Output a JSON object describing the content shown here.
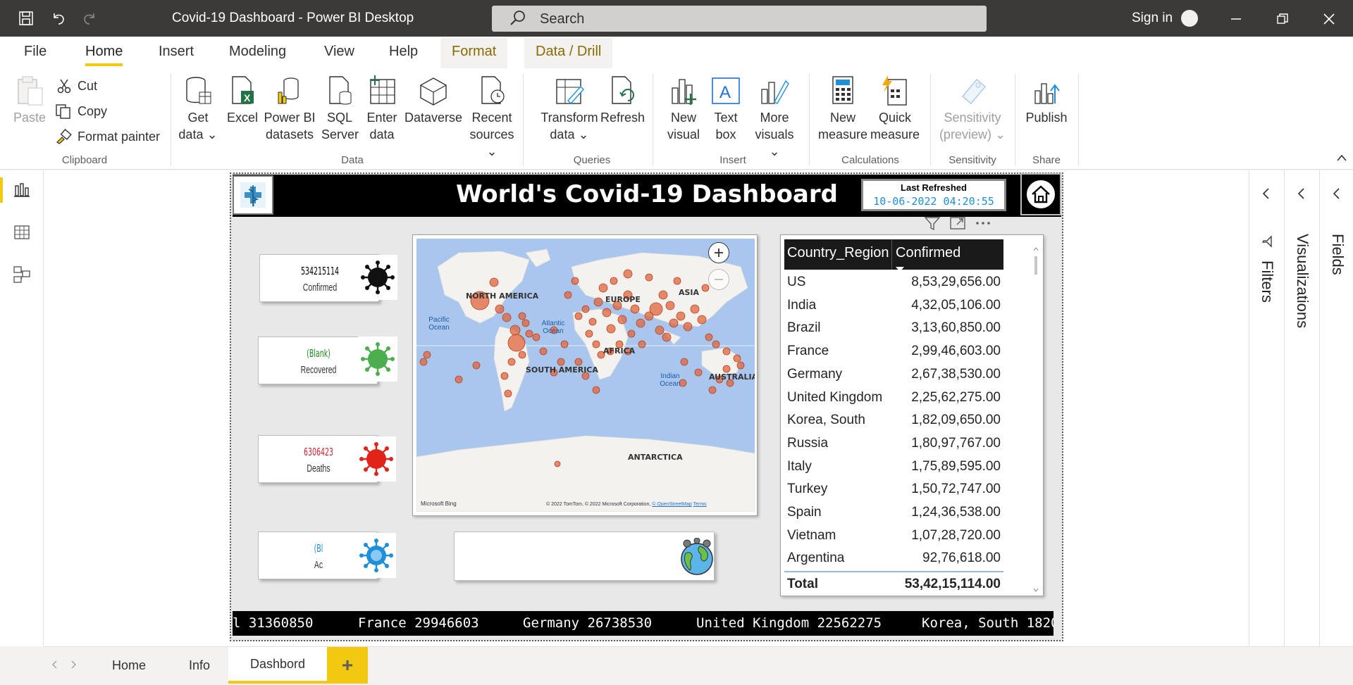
{
  "window": {
    "title": "Covid-19 Dashboard - Power BI Desktop",
    "search_label": "Search",
    "sign_in": "Sign in"
  },
  "menu_tabs": [
    "File",
    "Home",
    "Insert",
    "Modeling",
    "View",
    "Help",
    "Format",
    "Data / Drill"
  ],
  "ribbon": {
    "clipboard": {
      "paste": "Paste",
      "cut": "Cut",
      "copy": "Copy",
      "format_painter": "Format painter",
      "group": "Clipboard"
    },
    "data": {
      "get_data": [
        "Get",
        "data"
      ],
      "excel": "Excel",
      "pbi_datasets": [
        "Power BI",
        "datasets"
      ],
      "sql": [
        "SQL",
        "Server"
      ],
      "enter_data": [
        "Enter",
        "data"
      ],
      "dataverse": "Dataverse",
      "recent": [
        "Recent",
        "sources"
      ],
      "group": "Data"
    },
    "queries": {
      "transform": [
        "Transform",
        "data"
      ],
      "refresh": "Refresh",
      "group": "Queries"
    },
    "insert": {
      "new_visual": [
        "New",
        "visual"
      ],
      "text_box": [
        "Text",
        "box"
      ],
      "more_visuals": [
        "More",
        "visuals"
      ],
      "group": "Insert"
    },
    "calculations": {
      "new_measure": [
        "New",
        "measure"
      ],
      "quick_measure": [
        "Quick",
        "measure"
      ],
      "group": "Calculations"
    },
    "sensitivity": {
      "label": [
        "Sensitivity",
        "(preview)"
      ],
      "group": "Sensitivity"
    },
    "share": {
      "publish": "Publish",
      "group": "Share"
    }
  },
  "report": {
    "title": "World's Covid-19 Dashboard",
    "last_refreshed_label": "Last Refreshed",
    "last_refreshed_value": "10-06-2022 04:20:55",
    "cards": [
      {
        "value": "534215114",
        "label": "Confirmed",
        "color": "#000000"
      },
      {
        "value": "(Blank)",
        "label": "Recovered",
        "color": "#1f8a1f"
      },
      {
        "value": "6306423",
        "label": "Deaths",
        "color": "#d01f2f"
      },
      {
        "value": "(Bl",
        "label": "Ac",
        "color": "#1e8fd8"
      }
    ],
    "map": {
      "continents": [
        "NORTH AMERICA",
        "EUROPE",
        "ASIA",
        "AFRICA",
        "SOUTH AMERICA",
        "AUSTRALIA",
        "ANTARCTICA"
      ],
      "oceans": [
        "Pacific Ocean",
        "Atlantic Ocean",
        "Indian Ocean"
      ],
      "brand": "Microsoft Bing",
      "copyright": "© 2022 TomTom, © 2022 Microsoft Corporation,",
      "osm": "© OpenStreetMap",
      "terms": "Terms",
      "bubble_color": "#e0643c"
    },
    "table": {
      "headers": [
        "Country_Region",
        "Confirmed"
      ],
      "rows": [
        [
          "US",
          "8,53,29,656.00"
        ],
        [
          "India",
          "4,32,05,106.00"
        ],
        [
          "Brazil",
          "3,13,60,850.00"
        ],
        [
          "France",
          "2,99,46,603.00"
        ],
        [
          "Germany",
          "2,67,38,530.00"
        ],
        [
          "United Kingdom",
          "2,25,62,275.00"
        ],
        [
          "Korea, South",
          "1,82,09,650.00"
        ],
        [
          "Russia",
          "1,80,97,767.00"
        ],
        [
          "Italy",
          "1,75,89,595.00"
        ],
        [
          "Turkey",
          "1,50,72,747.00"
        ],
        [
          "Spain",
          "1,24,36,538.00"
        ],
        [
          "Vietnam",
          "1,07,28,720.00"
        ],
        [
          "Argentina",
          "92,76,618.00"
        ]
      ],
      "total_label": "Total",
      "total_value": "53,42,15,114.00"
    },
    "ticker": [
      "l 31360850",
      "France 29946603",
      "Germany 26738530",
      "United Kingdom 22562275",
      "Korea, South 1820"
    ]
  },
  "panes": {
    "filters": "Filters",
    "visualizations": "Visualizations",
    "fields": "Fields"
  },
  "pages": {
    "home": "Home",
    "info": "Info",
    "dashboard": "Dashbord",
    "add": "+"
  },
  "colors": {
    "accent": "#f2c811",
    "titlebar": "#3b3a39"
  }
}
